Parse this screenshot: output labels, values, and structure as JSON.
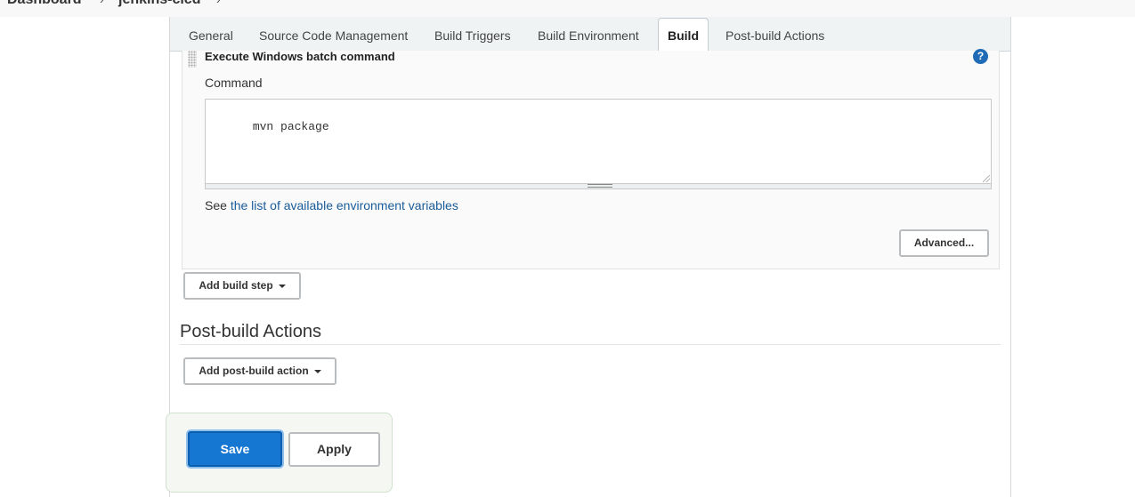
{
  "breadcrumb": {
    "items": [
      "Dashboard",
      "jenkins-cicd"
    ],
    "separator": "›"
  },
  "tabs": [
    {
      "label": "General"
    },
    {
      "label": "Source Code Management"
    },
    {
      "label": "Build Triggers"
    },
    {
      "label": "Build Environment"
    },
    {
      "label": "Build",
      "active": true
    },
    {
      "label": "Post-build Actions"
    }
  ],
  "build_step": {
    "title": "Execute Windows batch command",
    "help_symbol": "?",
    "command_label": "Command",
    "command_value": "mvn package",
    "env_prefix": "See",
    "env_link": "the list of available environment variables",
    "advanced_label": "Advanced..."
  },
  "add_build_step_label": "Add build step",
  "post_build": {
    "title": "Post-build Actions",
    "add_label": "Add post-build action"
  },
  "actions": {
    "save_label": "Save",
    "apply_label": "Apply"
  },
  "colors": {
    "primary": "#1577d1",
    "link": "#1a5b99",
    "help": "#1f6bb5"
  }
}
